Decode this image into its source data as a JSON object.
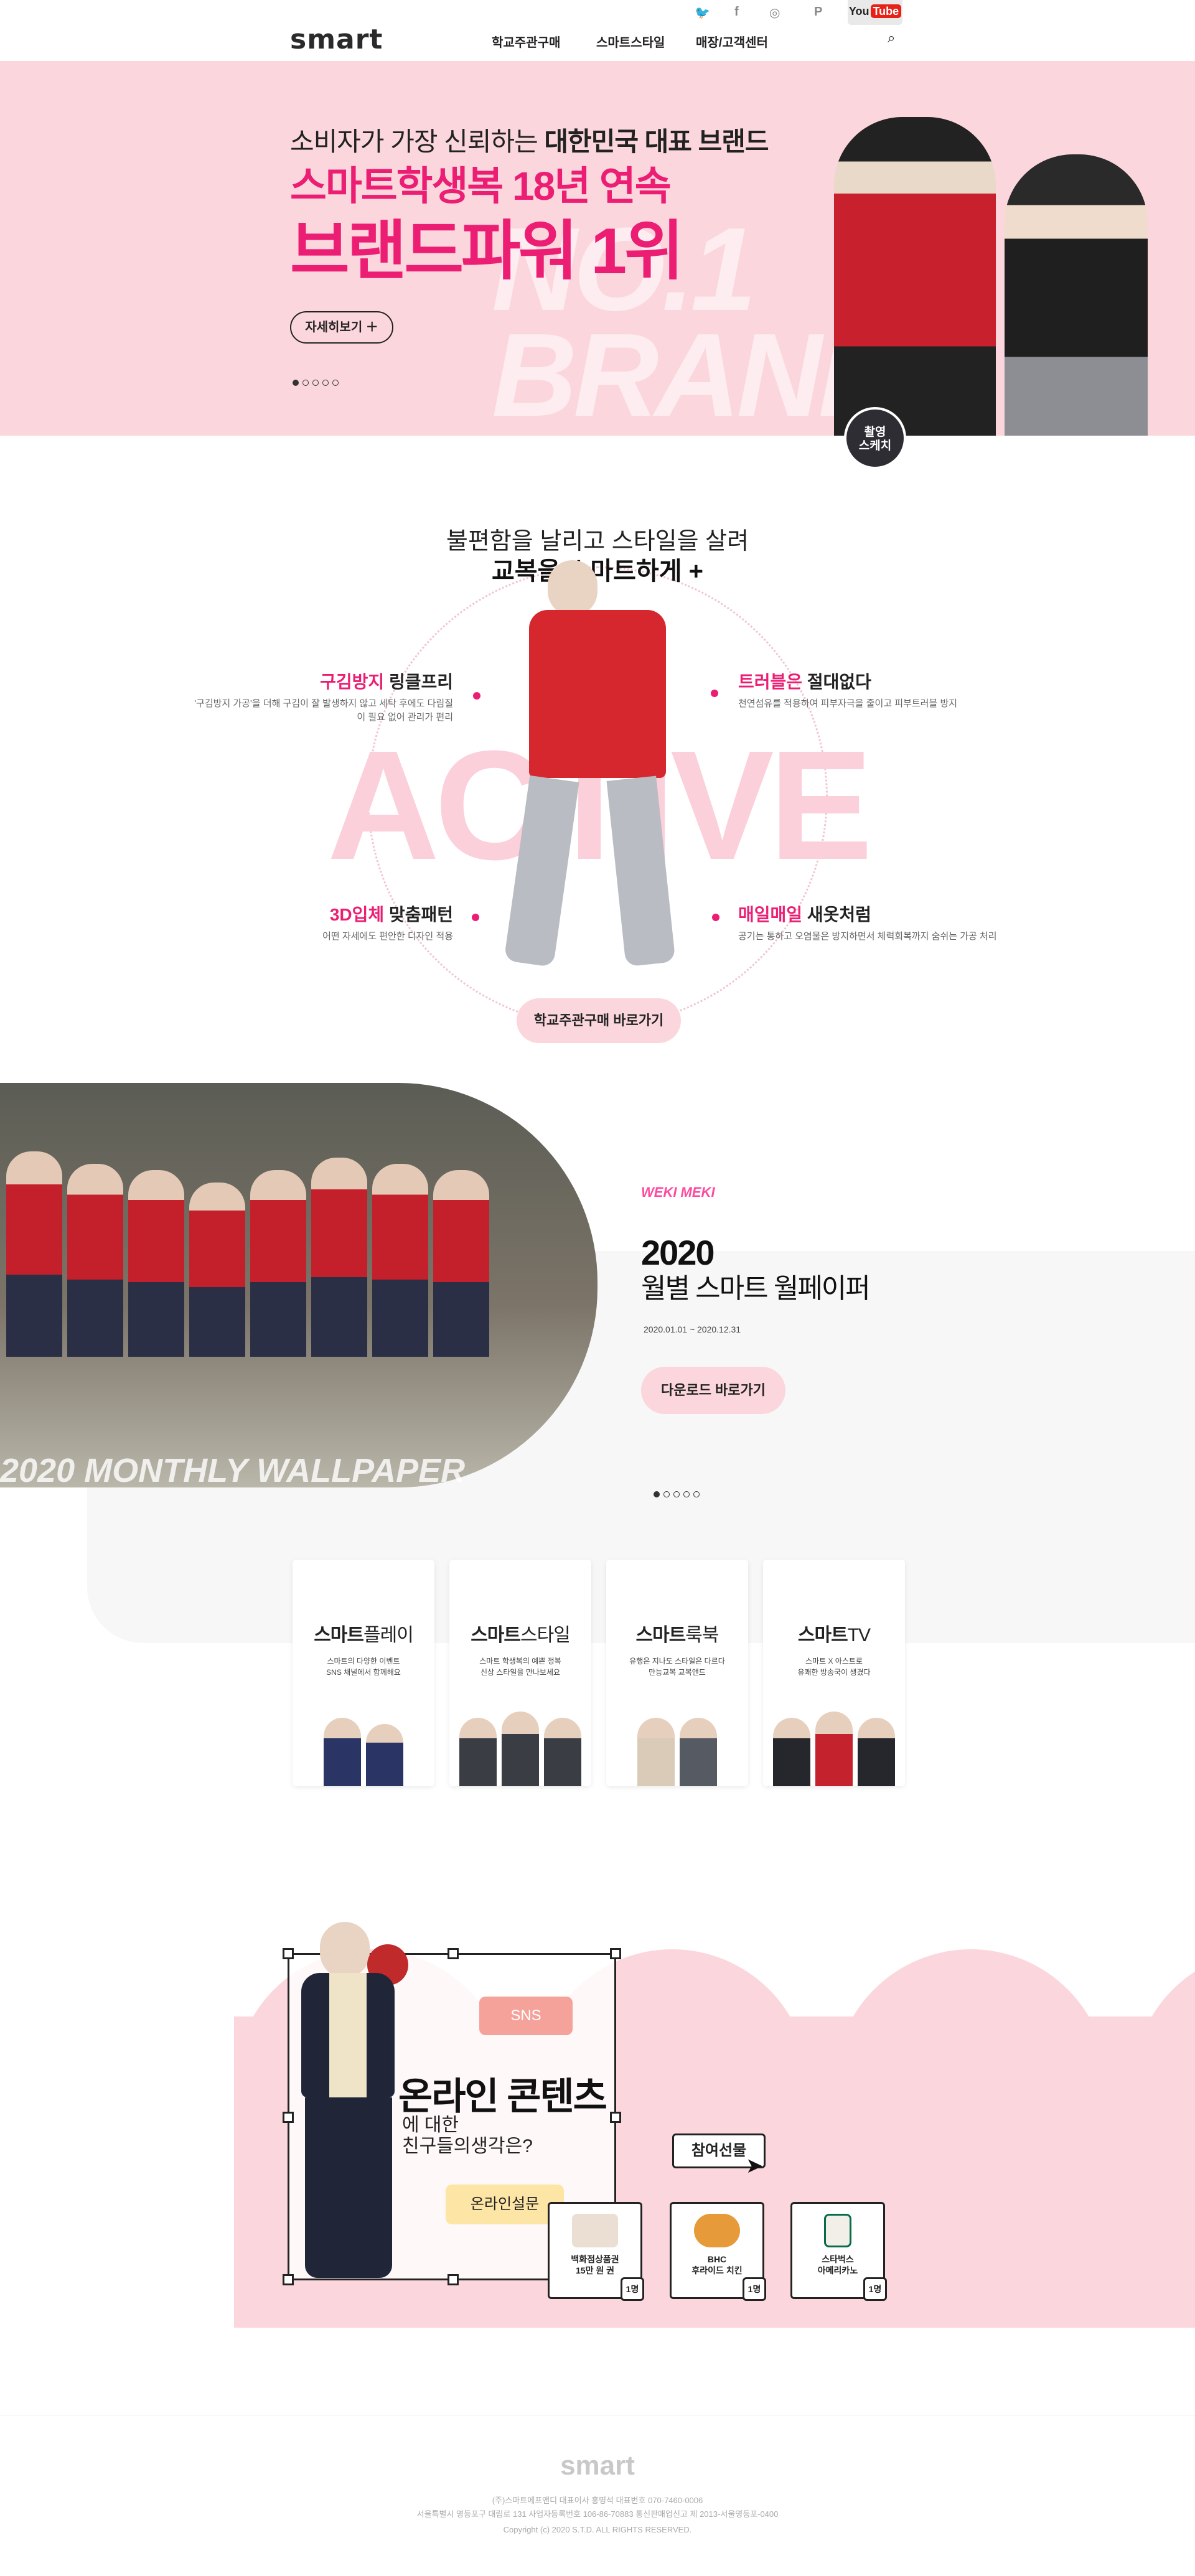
{
  "header": {
    "logo": "smart",
    "nav": [
      "학교주관구매",
      "스마트스타일",
      "매장/고객센터"
    ],
    "social": [
      "twitter-icon",
      "facebook-icon",
      "instagram-icon",
      "naver-post-icon"
    ],
    "youtube": {
      "you": "You",
      "tube": "Tube"
    }
  },
  "hero": {
    "subtitle_prefix": "소비자가 가장 신뢰하는 ",
    "subtitle_bold": "대한민국 대표 브랜드",
    "title1": "스마트학생복 18년 연속",
    "title2": "브랜드파워 1위",
    "bg_text": [
      "NO.1",
      "BRAND"
    ],
    "more_label": "자세히보기",
    "badge": "촬영\n스케치",
    "slides": 5,
    "active_slide": 1
  },
  "active": {
    "heading1": "불편함을 날리고 스타일을 살려",
    "heading2": "교복을 스마트하게 +",
    "bg_word": "ACTIVE",
    "features": [
      {
        "accent": "구김방지",
        "rest": " 링클프리",
        "desc": "'구김방지 가공'을 더해 구김이 잘 발생하지 않고 세탁 후에도 다림질이 필요 없어 관리가 편리"
      },
      {
        "accent": "트러블은",
        "rest": " 절대없다",
        "desc": "천연섬유를 적용하여 피부자극을 줄이고 피부트러블 방지"
      },
      {
        "accent": "3D입체",
        "rest": " 맞춤패턴",
        "desc": "어떤 자세에도 편안한 디자인 적용"
      },
      {
        "accent": "매일매일",
        "rest": " 새옷처럼",
        "desc": "공기는 통하고 오염물은 방지하면서 체력회복까지 숨쉬는 가공 처리"
      }
    ],
    "button": "학교주관구매 바로가기"
  },
  "wallpaper": {
    "brand": "WEKI MEKI",
    "year": "2020",
    "title": "월별 스마트 월페이퍼",
    "date": "2020.01.01 ~ 2020.12.31",
    "button": "다운로드 바로가기",
    "caption": "2020 MONTHLY WALLPAPER",
    "slides": 5,
    "active_slide": 1
  },
  "cards": [
    {
      "bold": "스마트",
      "light": "플레이",
      "desc": "스마트의 다양한 이벤트\nSNS 채널에서 함께해요"
    },
    {
      "bold": "스마트",
      "light": "스타일",
      "desc": "스마트 학생복의 예쁜 정복\n신상 스타일을 만나보세요"
    },
    {
      "bold": "스마트",
      "light": "룩북",
      "desc": "유행은 지나도 스타일은 다르다\n만능교복 교복앤드"
    },
    {
      "bold": "스마트",
      "light": "TV",
      "desc": "스마트 X 아스트로\n유쾌한 방송국이 생겼다"
    }
  ],
  "online": {
    "sns": "SNS",
    "title": "온라인 콘텐츠",
    "sub1": "에 대한",
    "sub2": "친구들의생각은?",
    "survey": "온라인설문",
    "gift_button": "참여선물",
    "gifts": [
      {
        "name": "백화점상품권\n15만 원 권",
        "qty": "1명"
      },
      {
        "name": "BHC\n후라이드 치킨",
        "qty": "1명"
      },
      {
        "name": "스타벅스\n아메리카노",
        "qty": "1명"
      }
    ]
  },
  "footer": {
    "logo": "smart",
    "line1": "(주)스마트에프앤디  대표이사 홍명석  대표번호 070-7460-0006",
    "line2": "서울특별시 영등포구 대림로 131  사업자등록번호 106-86-70883  통신판매업신고 제 2013-서울영등포-0400",
    "copyright": "Copyright (c) 2020 S.T.D. ALL RIGHTS RESERVED."
  }
}
